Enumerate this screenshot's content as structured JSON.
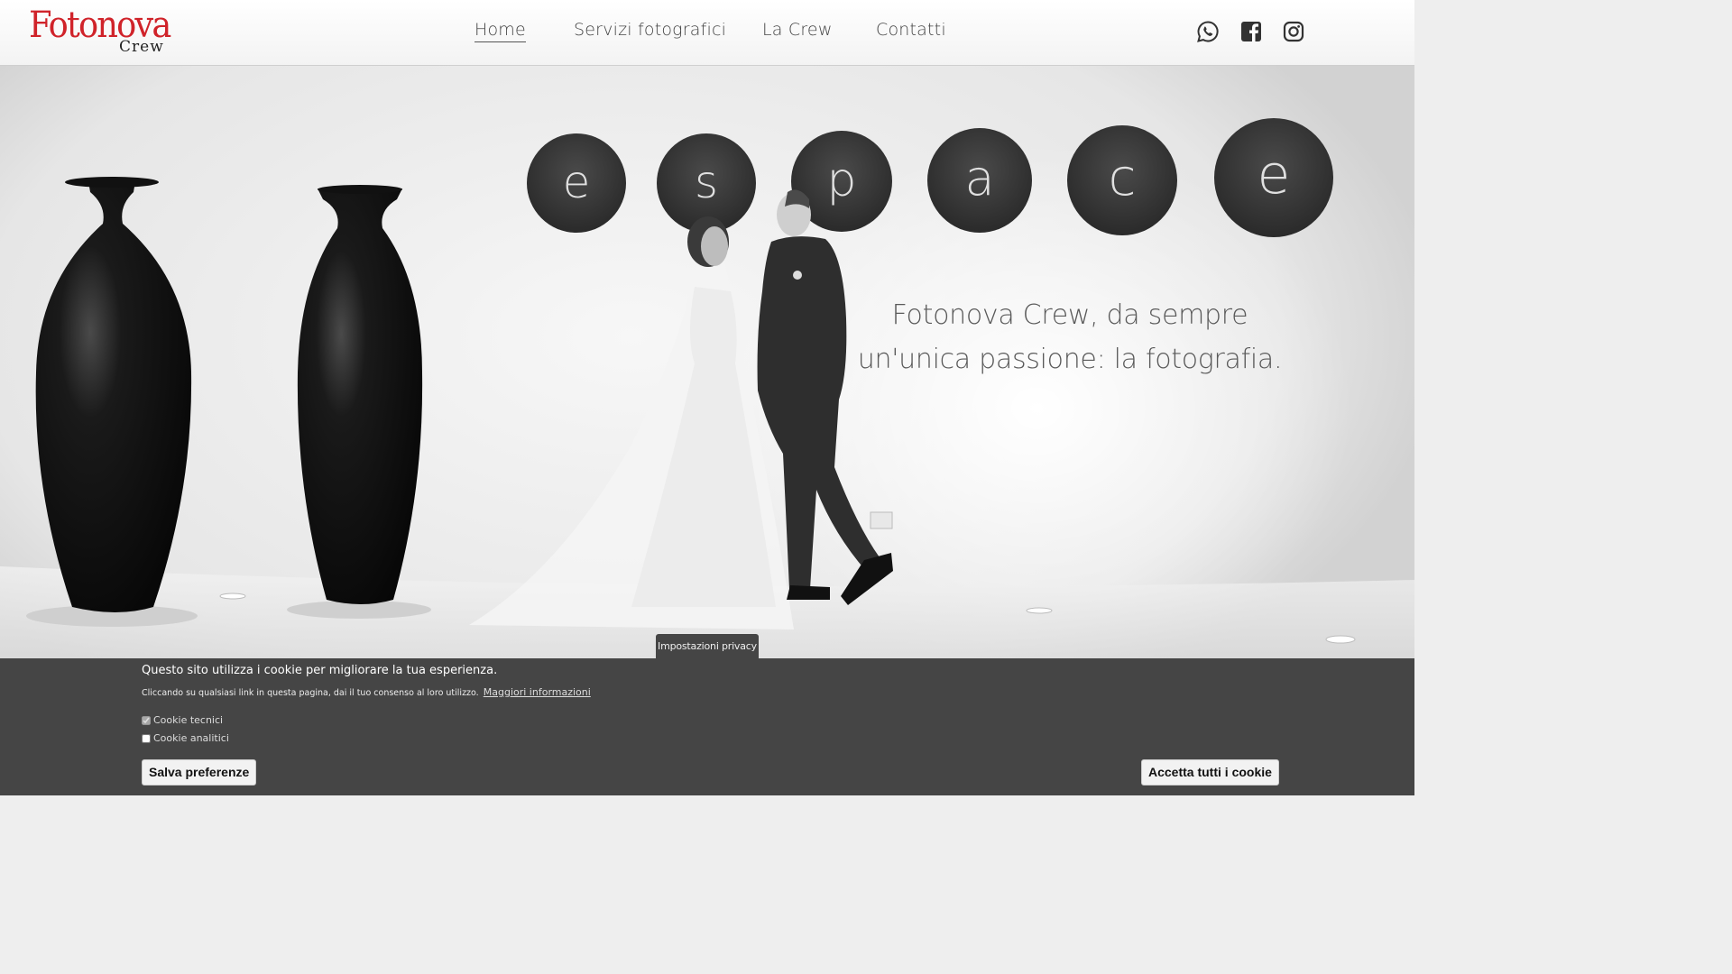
{
  "brand": {
    "logo_main": "Fotonova",
    "logo_sub": "Crew",
    "logo_color": "#d0232a"
  },
  "nav": {
    "items": [
      {
        "label": "Home",
        "active": true
      },
      {
        "label": "Servizi fotografici",
        "active": false
      },
      {
        "label": "La Crew",
        "active": false
      },
      {
        "label": "Contatti",
        "active": false
      }
    ]
  },
  "social": [
    "whatsapp-icon",
    "facebook-icon",
    "instagram-icon"
  ],
  "hero": {
    "wall_letters": [
      "e",
      "s",
      "p",
      "a",
      "c",
      "e"
    ],
    "tagline_line1": "Fotonova Crew, da sempre",
    "tagline_line2": "un'unica passione: la fotografia."
  },
  "privacy_tab": "Impostazioni privacy",
  "cookie": {
    "title": "Questo sito utilizza i cookie per migliorare la tua esperienza.",
    "text": "Cliccando su qualsiasi link in questa pagina, dai il tuo consenso al loro utilizzo.",
    "link": "Maggiori informazioni",
    "option_technical": "Cookie tecnici",
    "option_technical_checked": true,
    "option_analytics": "Cookie analitici",
    "option_analytics_checked": false,
    "save_button": "Salva preferenze",
    "accept_button": "Accetta tutti i cookie",
    "banner_color": "#454545"
  }
}
